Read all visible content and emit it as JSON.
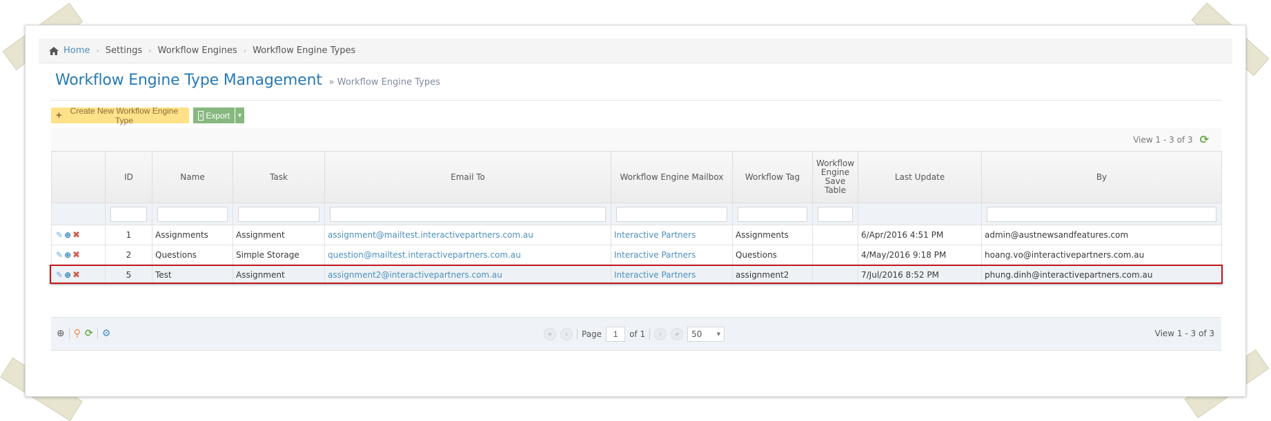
{
  "breadcrumbs": {
    "home": "Home",
    "items": [
      "Settings",
      "Workflow Engines",
      "Workflow Engine Types"
    ],
    "separator": "›"
  },
  "header": {
    "title": "Workflow Engine Type Management",
    "subtitle": "» Workflow Engine Types"
  },
  "toolbar": {
    "create_label": "Create New Workflow Engine Type",
    "create_icon": "+",
    "export_label": "Export",
    "export_icon": "x",
    "export_caret": "▼"
  },
  "grid": {
    "view_summary": "View 1 - 3 of 3",
    "refresh_icon": "⟳",
    "columns": [
      "",
      "ID",
      "Name",
      "Task",
      "Email To",
      "Workflow Engine Mailbox",
      "Workflow Tag",
      "Workflow Engine Save Table",
      "Last Update",
      "By"
    ],
    "rows": [
      {
        "id": "1",
        "name": "Assignments",
        "task": "Assignment",
        "email_to": "assignment@mailtest.interactivepartners.com.au",
        "mailbox": "Interactive Partners",
        "tag": "Assignments",
        "save_table": "",
        "last_update": "6/Apr/2016 4:51 PM",
        "by": "admin@austnewsandfeatures.com"
      },
      {
        "id": "2",
        "name": "Questions",
        "task": "Simple Storage",
        "email_to": "question@mailtest.interactivepartners.com.au",
        "mailbox": "Interactive Partners",
        "tag": "Questions",
        "save_table": "",
        "last_update": "4/May/2016 9:18 PM",
        "by": "hoang.vo@interactivepartners.com.au"
      },
      {
        "id": "5",
        "name": "Test",
        "task": "Assignment",
        "email_to": "assignment2@interactivepartners.com.au",
        "mailbox": "Interactive Partners",
        "tag": "assignment2",
        "save_table": "",
        "last_update": "7/Jul/2016 8:52 PM",
        "by": "phung.dinh@interactivepartners.com.au"
      }
    ],
    "row_action_icons": {
      "edit": "✎",
      "view": "⊕",
      "delete": "✖"
    }
  },
  "pager": {
    "first": "«",
    "prev": "‹",
    "next": "›",
    "last": "»",
    "page_label": "Page",
    "page_value": "1",
    "of_label": "of 1",
    "page_size": "50",
    "page_size_caret": "▼",
    "view_summary": "View 1 - 3 of 3",
    "icons": {
      "search": "⊕",
      "find": "⚲",
      "refresh": "⟳",
      "settings": "⚙"
    }
  },
  "colors": {
    "accent_blue": "#2679b5",
    "link_blue": "#4c8fbd",
    "create_button": "#fee188",
    "export_button": "#87b87f",
    "highlight_border": "#c4161c"
  }
}
